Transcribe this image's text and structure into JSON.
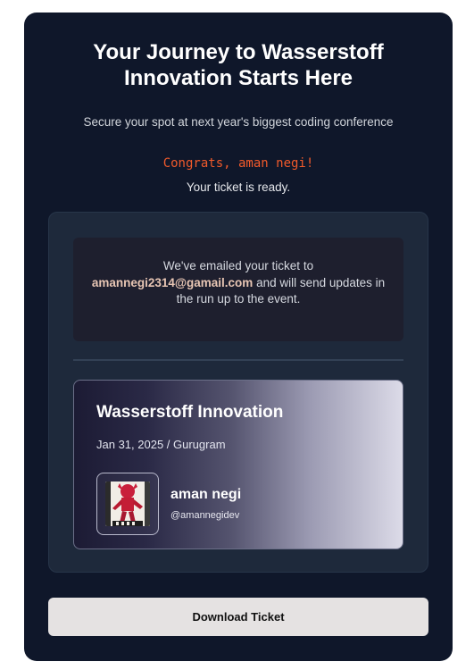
{
  "header": {
    "title": "Your Journey to Wasserstoff Innovation Starts Here",
    "subtitle": "Secure your spot at next year's biggest coding conference"
  },
  "confirmation": {
    "congrats": "Congrats, aman negi!",
    "ready": "Your ticket is ready."
  },
  "email_notice": {
    "prefix": "We've emailed your ticket to",
    "email": "amannegi2314@gamail.com",
    "suffix": "and will send updates in the run up to the event."
  },
  "ticket": {
    "event_name": "Wasserstoff Innovation",
    "event_meta": "Jan 31, 2025 / Gurugram",
    "attendee_name": "aman negi",
    "attendee_handle": "@amannegidev",
    "avatar_icon": "user-avatar-image"
  },
  "actions": {
    "download_label": "Download Ticket"
  },
  "colors": {
    "background": "#0f172a",
    "panel": "#1e293b",
    "congrats": "#f15a2b",
    "email_highlight": "#e8c6b4",
    "button": "#e5e2e2"
  }
}
